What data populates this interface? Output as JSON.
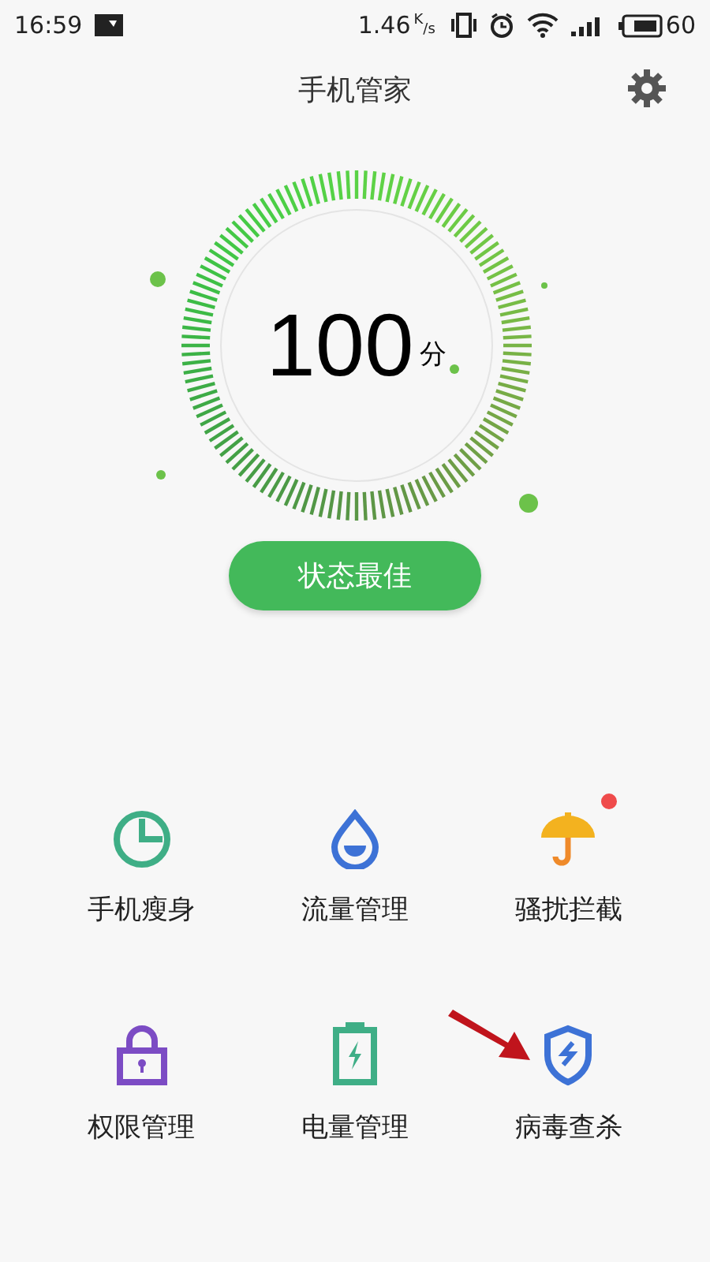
{
  "status_bar": {
    "time": "16:59",
    "speed": "1.46",
    "speed_unit_top": "K",
    "speed_unit_bottom": "/s",
    "battery": "60"
  },
  "header": {
    "title": "手机管家"
  },
  "score": {
    "value": "100",
    "unit": "分"
  },
  "status_button": {
    "label": "状态最佳"
  },
  "tools": [
    {
      "label": "手机瘦身",
      "badge": false
    },
    {
      "label": "流量管理",
      "badge": false
    },
    {
      "label": "骚扰拦截",
      "badge": true
    },
    {
      "label": "权限管理",
      "badge": false
    },
    {
      "label": "电量管理",
      "badge": false
    },
    {
      "label": "病毒查杀",
      "badge": false
    }
  ]
}
